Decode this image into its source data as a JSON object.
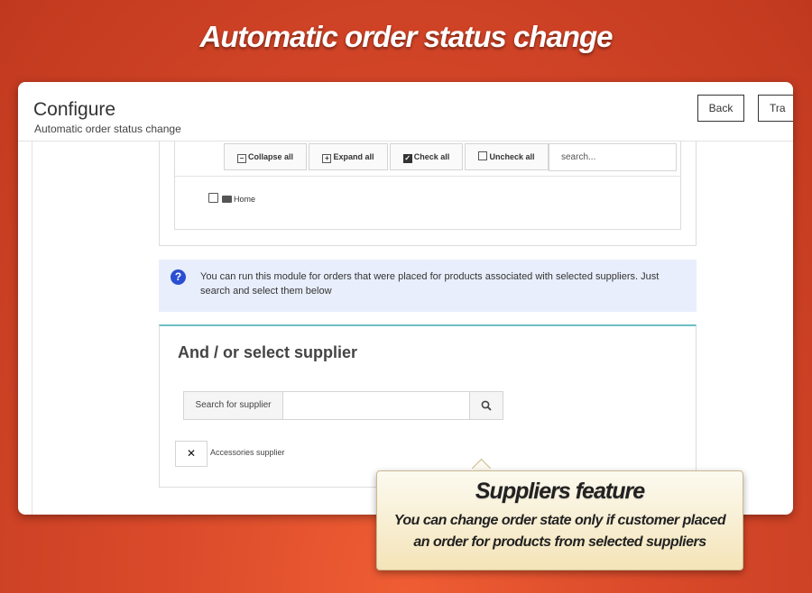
{
  "banner": {
    "title": "Automatic order status change"
  },
  "header": {
    "title": "Configure",
    "subtitle": "Automatic order status change",
    "back_label": "Back",
    "translate_label": "Tra"
  },
  "tree_toolbar": {
    "collapse_label": "Collapse all",
    "expand_label": "Expand all",
    "check_label": "Check all",
    "uncheck_label": "Uncheck all",
    "search_placeholder": "search..."
  },
  "tree": {
    "root_label": "Home"
  },
  "info": {
    "text": "You can run this module for orders that were placed for products associated with selected suppliers. Just search and select them below"
  },
  "supplier_panel": {
    "title": "And / or select supplier",
    "search_label": "Search for supplier",
    "selected": [
      "Accessories supplier"
    ]
  },
  "callout": {
    "title": "Suppliers feature",
    "text": "You can change order state only if customer placed an order for products from selected suppliers"
  },
  "colors": {
    "accent_teal": "#6bbfc3",
    "info_icon": "#2b4fd2",
    "background": "#d9492a"
  }
}
